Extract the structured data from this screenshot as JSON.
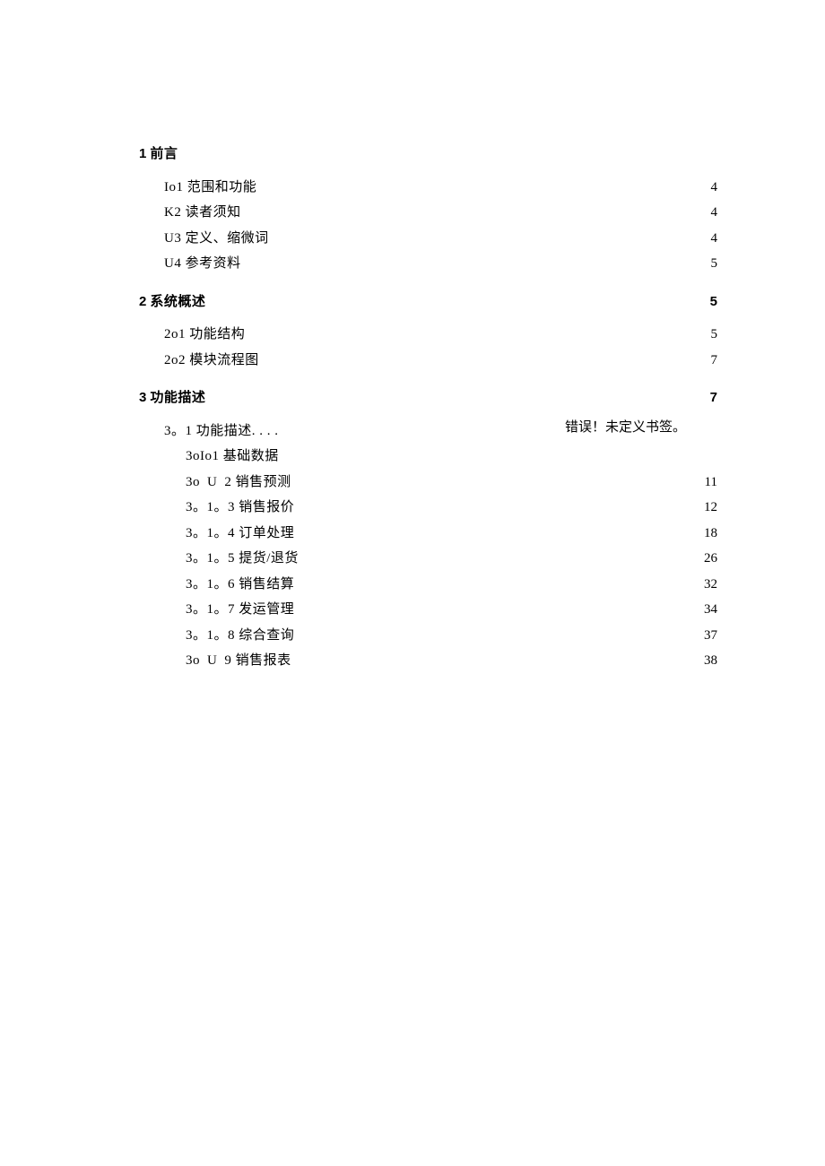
{
  "sections": [
    {
      "heading_num": "1",
      "heading_text": "前言",
      "heading_page": "",
      "heading_has_dots": false,
      "items": [
        {
          "label": "Io1 范围和功能",
          "page": "4",
          "indent": 1
        },
        {
          "label": "K2 读者须知",
          "page": "4",
          "indent": 1
        },
        {
          "label": "U3 定义、缩微词",
          "page": "4",
          "indent": 1
        },
        {
          "label": "U4 参考资料",
          "page": "5",
          "indent": 1
        }
      ]
    },
    {
      "heading_num": "2",
      "heading_text": "系统概述",
      "heading_page": "5",
      "heading_has_dots": true,
      "items": [
        {
          "label": "2o1 功能结构",
          "page": "5",
          "indent": 1
        },
        {
          "label": "2o2 模块流程图",
          "page": "7",
          "indent": 1
        }
      ]
    },
    {
      "heading_num": "3",
      "heading_text": "功能描述",
      "heading_page": "7",
      "heading_has_dots": true,
      "error_block": {
        "line1": "3。1 功能描述. . . .",
        "line2": "3oIo1 基础数据",
        "note": "错误！未定义书签。"
      },
      "items": [
        {
          "label": "3o U 2 销售预测",
          "page": "11",
          "indent": 2
        },
        {
          "label": "3。1。3 销售报价",
          "page": "12",
          "indent": 2
        },
        {
          "label": "3。1。4 订单处理",
          "page": "18",
          "indent": 2
        },
        {
          "label": "3。1。5 提货/退货",
          "page": "26",
          "indent": 2
        },
        {
          "label": "3。1。6 销售结算",
          "page": "32",
          "indent": 2
        },
        {
          "label": "3。1。7 发运管理",
          "page": "34",
          "indent": 2
        },
        {
          "label": "3。1。8 综合查询",
          "page": "37",
          "indent": 2
        },
        {
          "label": "3o U 9 销售报表",
          "page": "38",
          "indent": 2
        }
      ]
    }
  ]
}
